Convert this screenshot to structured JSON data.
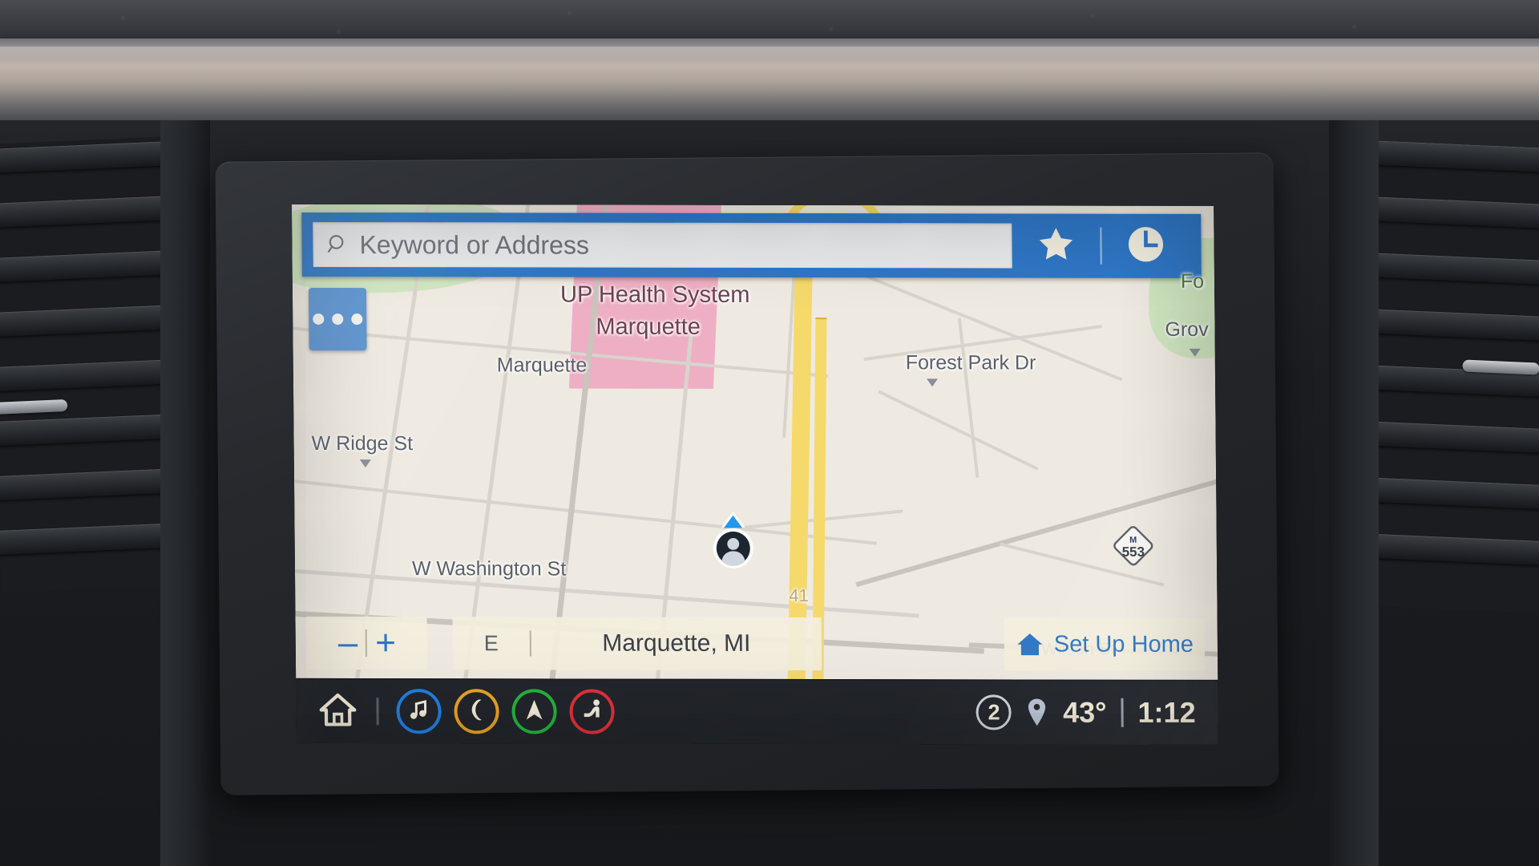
{
  "search": {
    "placeholder": "Keyword or Address",
    "search_icon": "search-icon",
    "favorites_icon": "star-icon",
    "recents_icon": "clock-icon"
  },
  "map": {
    "more_options_icon": "ellipsis-icon",
    "labels": [
      {
        "text": "UP Health System",
        "kind": "poi"
      },
      {
        "text": "Marquette",
        "kind": "poi"
      },
      {
        "text": "Marquette",
        "kind": "street"
      },
      {
        "text": "Forest Park Dr",
        "kind": "street"
      },
      {
        "text": "Grov",
        "kind": "street"
      },
      {
        "text": "Fo",
        "kind": "park"
      },
      {
        "text": "W Ridge St",
        "kind": "street"
      },
      {
        "text": "W Washington St",
        "kind": "street"
      },
      {
        "text": "Wilson St",
        "kind": "street"
      },
      {
        "text": "41",
        "kind": "shield"
      }
    ],
    "highway_shield": {
      "state": "M",
      "number": "553"
    },
    "vehicle_marker_icon": "vehicle-position-icon"
  },
  "controls": {
    "zoom_out_label": "–",
    "zoom_in_label": "+",
    "compass_heading": "E",
    "current_location": "Marquette, MI",
    "set_up_home_label": "Set Up Home",
    "home_icon": "house-icon"
  },
  "systembar": {
    "home_icon": "home-icon",
    "apps": [
      {
        "name": "audio",
        "icon": "music-note-icon",
        "color": "#1f7fe0"
      },
      {
        "name": "phone",
        "icon": "phone-handset-icon",
        "color": "#e8a320"
      },
      {
        "name": "navigation",
        "icon": "navigation-arrow-icon",
        "color": "#24b33c"
      },
      {
        "name": "vehicle",
        "icon": "seated-person-icon",
        "color": "#e0303a"
      }
    ],
    "profile_number": "2",
    "location_icon": "map-pin-icon",
    "temperature": "43°",
    "clock": "1:12"
  },
  "colors": {
    "header_blue": "#2f77c6",
    "accent_blue": "#2f77c6",
    "map_land": "#efeae1",
    "map_green": "#cfe6bf",
    "map_hospital": "#eeafc4",
    "highway_yellow": "#f5d96b",
    "sysbar": "#22252b"
  }
}
